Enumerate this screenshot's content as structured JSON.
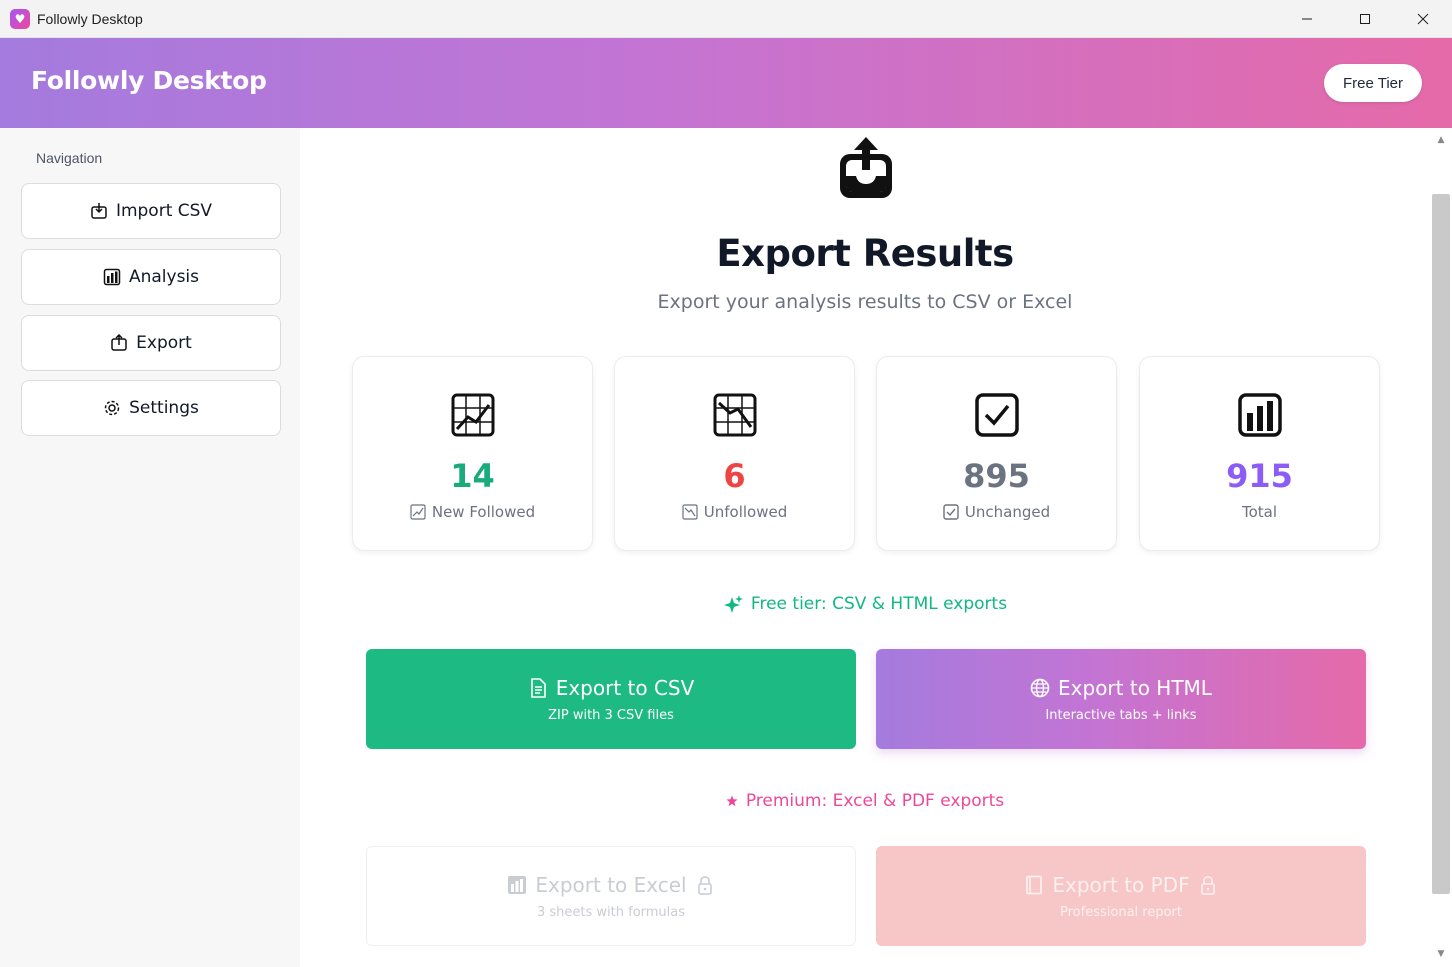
{
  "window": {
    "title": "Followly Desktop",
    "icon": "heart-app-icon",
    "controls": [
      "minimize-icon",
      "maximize-icon",
      "close-icon"
    ]
  },
  "header": {
    "title": "Followly Desktop",
    "tier_badge": "Free Tier",
    "gradient_colors": [
      "#a47bde",
      "#c474d3",
      "#e56aa9"
    ]
  },
  "sidebar": {
    "heading": "Navigation",
    "items": [
      {
        "label": "Import CSV",
        "icon": "import-icon"
      },
      {
        "label": "Analysis",
        "icon": "bar-chart-icon"
      },
      {
        "label": "Export",
        "icon": "export-icon"
      },
      {
        "label": "Settings",
        "icon": "gear-icon"
      }
    ]
  },
  "main": {
    "hero_icon": "export-tray-icon",
    "title": "Export Results",
    "subtitle": "Export your analysis results to CSV or Excel",
    "stats": [
      {
        "value": "14",
        "label": "New Followed",
        "color": "#1aab7c",
        "icon": "trend-up-chart-icon"
      },
      {
        "value": "6",
        "label": "Unfollowed",
        "color": "#ef4444",
        "icon": "trend-down-chart-icon"
      },
      {
        "value": "895",
        "label": "Unchanged",
        "color": "#6b7280",
        "icon": "checkbox-icon"
      },
      {
        "value": "915",
        "label": "Total",
        "color": "#8b5cf6",
        "icon": "bar-chart-icon"
      }
    ],
    "free_note": "Free tier: CSV & HTML exports",
    "premium_note": "Premium: Excel & PDF exports",
    "exports": {
      "csv": {
        "title": "Export to CSV",
        "subtitle": "ZIP with 3 CSV files",
        "color": "#1dba84"
      },
      "html": {
        "title": "Export to HTML",
        "subtitle": "Interactive tabs + links"
      },
      "excel": {
        "title": "Export to Excel",
        "subtitle": "3 sheets with formulas",
        "locked": true
      },
      "pdf": {
        "title": "Export to PDF",
        "subtitle": "Professional report",
        "locked": true,
        "color": "#f7c6c6"
      }
    }
  }
}
